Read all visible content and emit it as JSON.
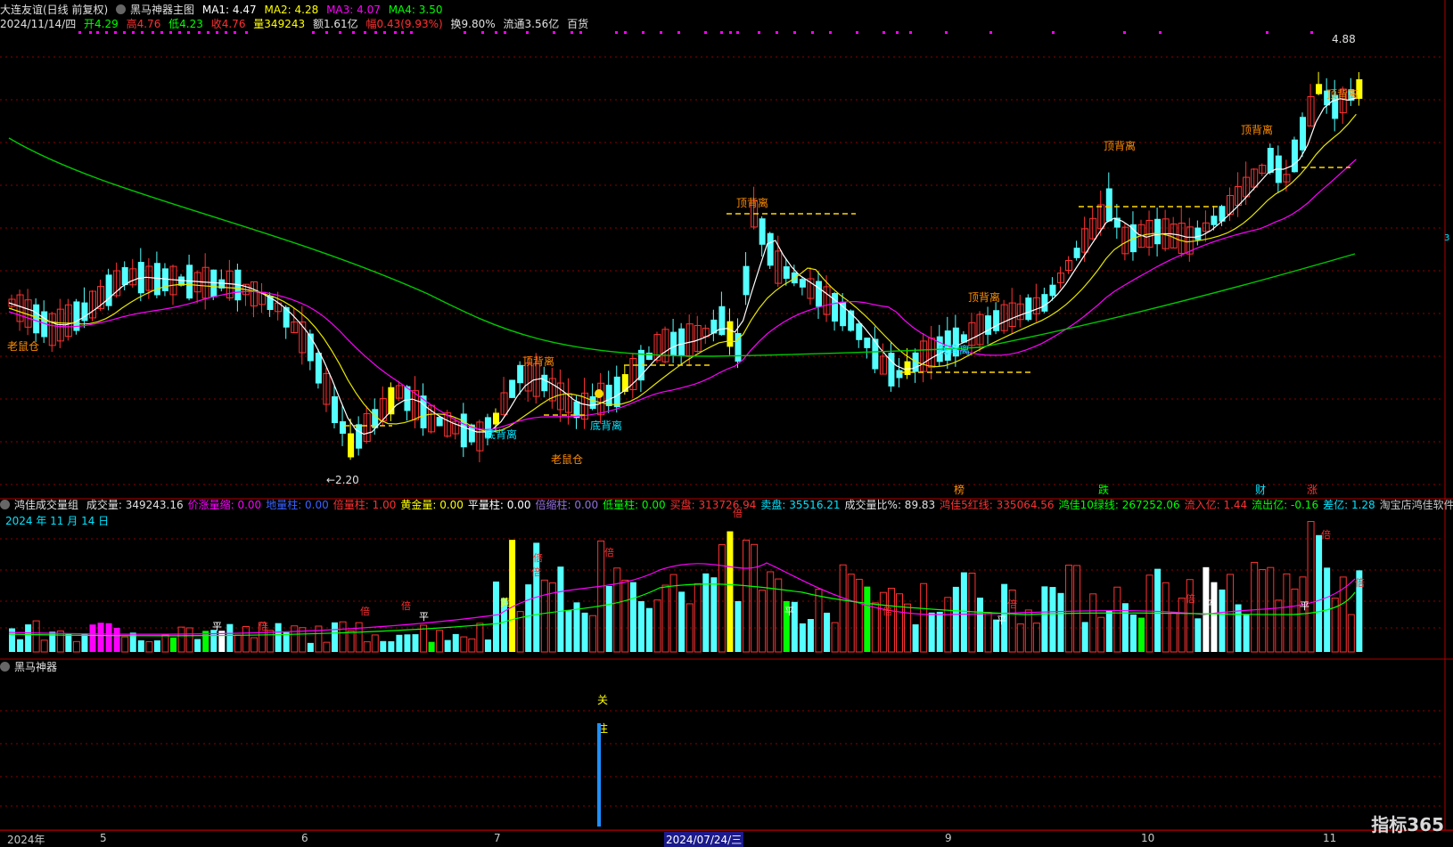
{
  "header": {
    "stock": "大连友谊(日线 前复权)",
    "indicator": "黑马神器主图",
    "ma1": "MA1: 4.47",
    "ma2": "MA2: 4.28",
    "ma3": "MA3: 4.07",
    "ma4": "MA4: 3.50",
    "date": "2024/11/14/四",
    "open": "开4.29",
    "high": "高4.76",
    "low": "低4.23",
    "close": "收4.76",
    "volume": "量349243",
    "amount": "额1.61亿",
    "change": "幅0.43(9.93%)",
    "turnover": "换9.80%",
    "float": "流通3.56亿",
    "sector": "百货"
  },
  "vol_header": {
    "name": "鸿佳成交量组",
    "items": [
      {
        "label": "成交量: 349243.16",
        "color": "#e0e0e0"
      },
      {
        "label": "价涨量缩: 0.00",
        "color": "#ff00ff"
      },
      {
        "label": "地量柱: 0.00",
        "color": "#3a62ff"
      },
      {
        "label": "倍量柱: 1.00",
        "color": "#ff3030"
      },
      {
        "label": "黄金量: 0.00",
        "color": "#ffff00"
      },
      {
        "label": "平量柱: 0.00",
        "color": "#ffffff"
      },
      {
        "label": "倍缩柱: 0.00",
        "color": "#9370db"
      },
      {
        "label": "低量柱: 0.00",
        "color": "#00ff00"
      },
      {
        "label": "买盘: 313726.94",
        "color": "#ff3030"
      },
      {
        "label": "卖盘: 35516.21",
        "color": "#00e5ff"
      },
      {
        "label": "成交量比%: 89.83",
        "color": "#e0e0e0"
      },
      {
        "label": "鸿佳5红线: 335064.56",
        "color": "#ff3030"
      },
      {
        "label": "鸿佳10绿线: 267252.06",
        "color": "#00ff00"
      },
      {
        "label": "流入亿: 1.44",
        "color": "#ff3030"
      },
      {
        "label": "流出亿: -0.16",
        "color": "#00ff00"
      },
      {
        "label": "差亿: 1.28",
        "color": "#00e5ff"
      },
      {
        "label": "淘宝店鸿佳软件",
        "color": "#c8c8c8"
      }
    ],
    "date_label": "2024 年 11 月 14 日"
  },
  "sub_header": {
    "name": "黑马神器"
  },
  "annotations": {
    "laoshu1": "老鼠仓",
    "laoshu2": "老鼠仓",
    "low_price": "←2.20",
    "high_price": "4.88",
    "dibeili": "底背离",
    "dingbeili": "顶背离",
    "bang": "榜",
    "die": "跌",
    "cai": "财",
    "zhang": "涨",
    "guan": "关",
    "zhu": "注",
    "bei": "倍",
    "ping": "平",
    "huang": "黄"
  },
  "date_axis": [
    "2024年",
    "5",
    "6",
    "7",
    "2024/07/24/三",
    "9",
    "10",
    "11"
  ],
  "right_scale": "3",
  "logo": "指标365",
  "colors": {
    "up": "#ff3232",
    "down": "#54ffff",
    "yellow": "#ffff00",
    "ma_white": "#ffffff",
    "ma_yellow": "#e6e600",
    "ma_magenta": "#ff00ff",
    "ma_green": "#00c800",
    "grid": "#8b0000"
  }
}
